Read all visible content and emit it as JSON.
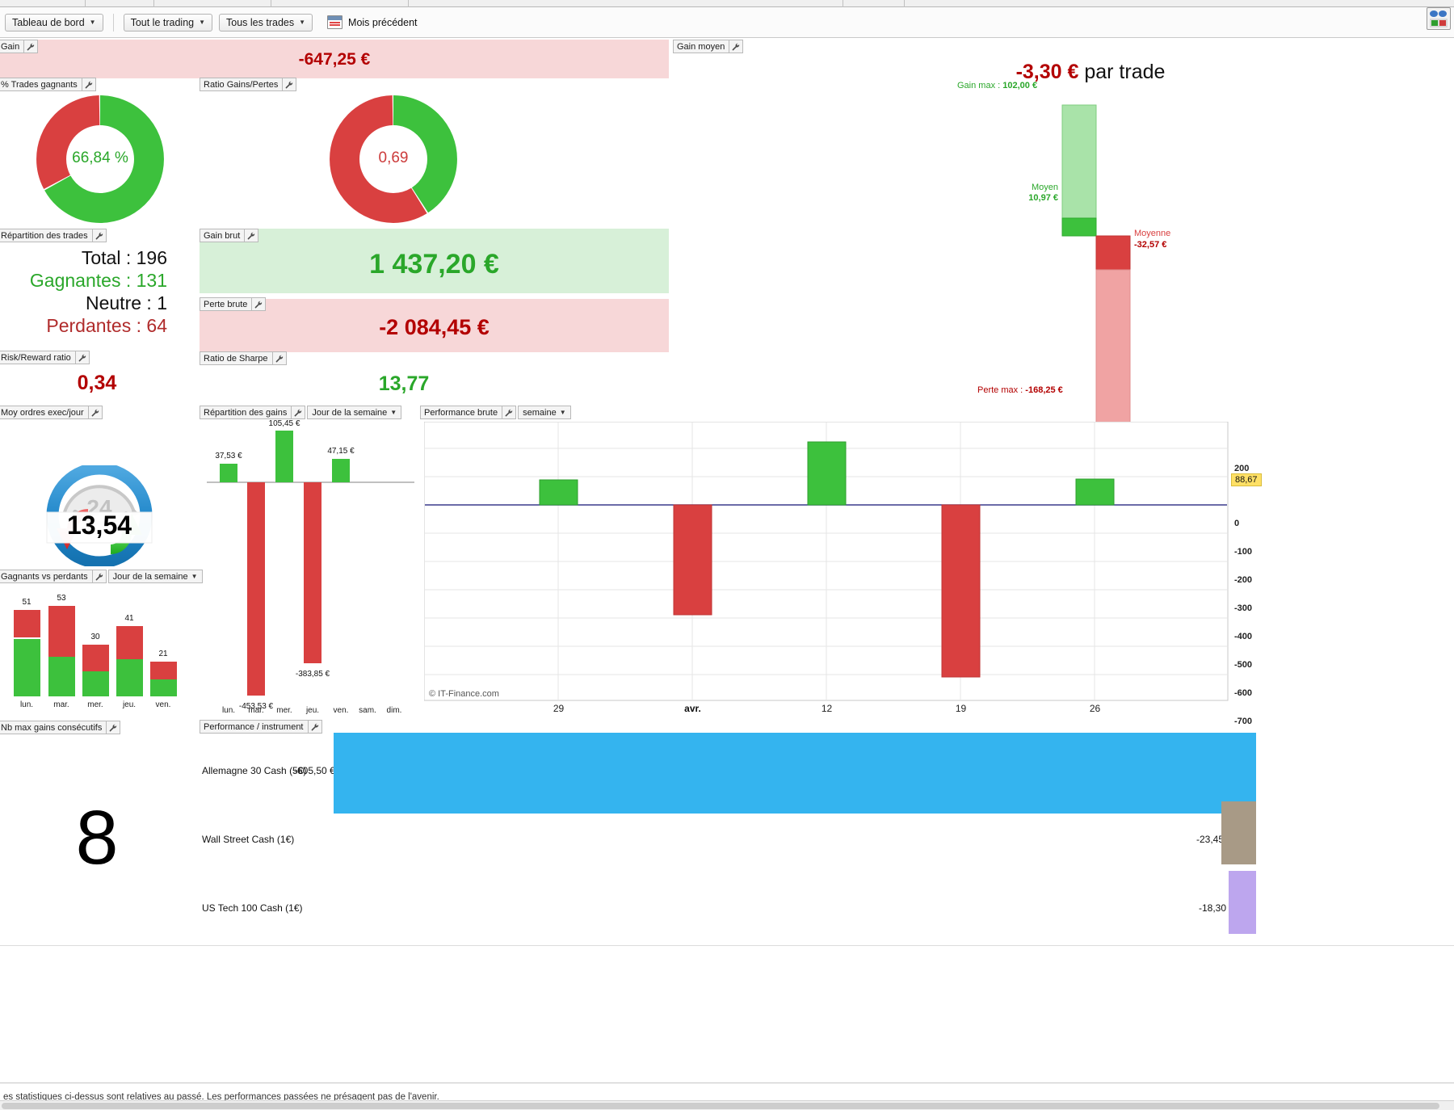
{
  "toolbar": {
    "dashboard_button": "Tableau de bord",
    "scope_button": "Tout le trading",
    "trades_button": "Tous les trades",
    "period_label": "Mois précédent"
  },
  "panels": {
    "gain": {
      "title": "Gain",
      "value": "-647,25 €"
    },
    "winrate": {
      "title": "% Trades gagnants",
      "value": "66,84 %"
    },
    "ratio_gains_pertes": {
      "title": "Ratio Gains/Pertes",
      "value": "0,69"
    },
    "repartition_trades": {
      "title": "Répartition des trades",
      "rows": [
        {
          "label": "Total",
          "value": "196"
        },
        {
          "label": "Gagnantes",
          "value": "131"
        },
        {
          "label": "Neutre",
          "value": "1"
        },
        {
          "label": "Perdantes",
          "value": "64"
        }
      ]
    },
    "risk_reward": {
      "title": "Risk/Reward ratio",
      "value": "0,34"
    },
    "moy_ordres": {
      "title": "Moy ordres exec/jour",
      "value": "13,54",
      "dial_label": "24"
    },
    "gain_brut": {
      "title": "Gain brut",
      "value": "1 437,20 €"
    },
    "perte_brute": {
      "title": "Perte brute",
      "value": "-2 084,45 €"
    },
    "ratio_sharpe": {
      "title": "Ratio de Sharpe",
      "value": "13,77"
    },
    "gain_moyen": {
      "title": "Gain moyen",
      "headline_value": "-3,30 €",
      "headline_suffix": " par trade",
      "gain_max_label": "Gain max : ",
      "gain_max_value": "102,00 €",
      "moyen_gain_label": "Moyen",
      "moyen_gain_value": "10,97 €",
      "moyenne_perte_label": "Moyenne",
      "moyenne_perte_value": "-32,57 €",
      "perte_max_label": "Perte max : ",
      "perte_max_value": "-168,25 €"
    },
    "gagnants_vs_perdants": {
      "title": "Gagnants vs perdants",
      "dropdown": "Jour de la semaine"
    },
    "repartition_gains": {
      "title": "Répartition des gains",
      "dropdown": "Jour de la semaine"
    },
    "performance_brute": {
      "title": "Performance brute",
      "dropdown": "semaine",
      "watermark": "© IT-Finance.com"
    },
    "nb_max_gains": {
      "title": "Nb max gains consécutifs",
      "value": "8"
    },
    "performance_instrument": {
      "title": "Performance / instrument"
    }
  },
  "colors": {
    "green": "#3dc13d",
    "green_light": "#a9e3a9",
    "red": "#d94040",
    "red_light": "#f0a3a3",
    "dark_red_text": "#b30000",
    "green_text": "#2aa72a",
    "blue_bar": "#34b4ef",
    "tan_bar": "#a89a86",
    "violet_bar": "#bda6ee",
    "band_red": "#f7d7d8",
    "band_green": "#d7f0d8",
    "axis_line": "#3a3a8c",
    "badge_yellow": "#ffe066"
  },
  "footer": {
    "disclaimer": "es statistiques ci-dessus sont relatives au passé. Les performances passées ne présagent pas de l'avenir."
  },
  "chart_data": [
    {
      "name": "winrate_donut",
      "type": "pie",
      "title": "% Trades gagnants",
      "center_label": "66,84 %",
      "categories": [
        "Gagnants",
        "Perdants"
      ],
      "values": [
        66.84,
        33.16
      ],
      "colors": [
        "#3dc13d",
        "#d94040"
      ]
    },
    {
      "name": "ratio_gains_pertes_donut",
      "type": "pie",
      "title": "Ratio Gains/Pertes",
      "center_label": "0,69",
      "categories": [
        "Gains",
        "Pertes"
      ],
      "values": [
        40.8,
        59.2
      ],
      "colors": [
        "#3dc13d",
        "#d94040"
      ]
    },
    {
      "name": "gain_moyen_waterfall",
      "type": "bar",
      "title": "Gain moyen",
      "categories": [
        "Gain max",
        "Moyen gain",
        "Moyenne perte",
        "Perte max"
      ],
      "values": [
        102.0,
        10.97,
        -32.57,
        -168.25
      ],
      "ylabel": "€",
      "annotations": [
        {
          "label": "Gain max : 102,00 €",
          "color": "#2aa72a"
        },
        {
          "label": "Moyen 10,97 €",
          "color": "#2aa72a"
        },
        {
          "label": "Moyenne -32,57 €",
          "color": "#b30000"
        },
        {
          "label": "Perte max : -168,25 €",
          "color": "#b30000"
        }
      ]
    },
    {
      "name": "gagnants_vs_perdants",
      "type": "bar",
      "title": "Gagnants vs perdants",
      "xlabel": "Jour de la semaine",
      "categories": [
        "lun.",
        "mar.",
        "mer.",
        "jeu.",
        "ven."
      ],
      "totals": [
        51,
        53,
        30,
        41,
        21
      ],
      "series": [
        {
          "name": "Gagnants",
          "values": [
            36,
            28,
            16,
            28,
            13
          ],
          "color": "#3dc13d"
        },
        {
          "name": "Perdants",
          "values": [
            15,
            25,
            14,
            13,
            8
          ],
          "color": "#d94040"
        }
      ],
      "data_labels": [
        "51",
        "53",
        "30",
        "41",
        "21"
      ]
    },
    {
      "name": "repartition_des_gains",
      "type": "bar",
      "title": "Répartition des gains",
      "xlabel": "Jour de la semaine",
      "categories": [
        "lun.",
        "mar.",
        "mer.",
        "jeu.",
        "ven.",
        "sam.",
        "dim."
      ],
      "values": [
        37.53,
        -453.53,
        105.45,
        -383.85,
        47.15,
        0,
        0
      ],
      "data_labels": [
        "37,53 €",
        "-453,53 €",
        "105,45 €",
        "-383,85 €",
        "47,15 €",
        "",
        ""
      ],
      "ylabel": "€"
    },
    {
      "name": "performance_brute",
      "type": "bar",
      "title": "Performance brute",
      "xlabel": "semaine",
      "categories": [
        "29",
        "avr.",
        "12",
        "19",
        "26"
      ],
      "values": [
        88,
        -390,
        225,
        -610,
        90
      ],
      "ylim": [
        -700,
        260
      ],
      "yticks": [
        200,
        100,
        0,
        -100,
        -200,
        -300,
        -400,
        -500,
        -600,
        -700
      ],
      "ytick_labels": [
        "200",
        "",
        "0",
        "-100",
        "-200",
        "-300",
        "-400",
        "-500",
        "-600",
        "-700"
      ],
      "marker_value": "88,67",
      "grid": true,
      "watermark": "© IT-Finance.com"
    },
    {
      "name": "performance_instrument",
      "type": "bar",
      "title": "Performance / instrument",
      "orientation": "horizontal",
      "categories": [
        "Allemagne 30 Cash (5€)",
        "Wall Street Cash (1€)",
        "US Tech 100 Cash (1€)"
      ],
      "values": [
        -605.5,
        -23.45,
        -18.3
      ],
      "data_labels": [
        "-605,50 €",
        "-23,45 €",
        "-18,30 €"
      ],
      "colors": [
        "#34b4ef",
        "#a89a86",
        "#bda6ee"
      ]
    }
  ]
}
